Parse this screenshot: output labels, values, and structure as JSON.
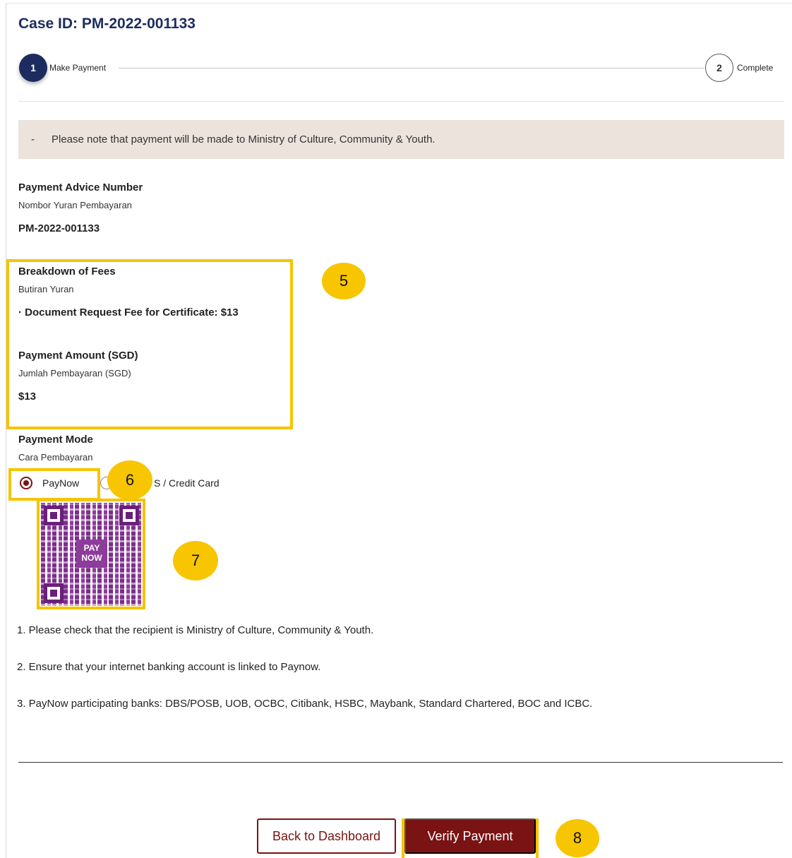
{
  "case": {
    "title": "Case ID: PM-2022-001133"
  },
  "stepper": {
    "steps": [
      {
        "number": "1",
        "label": "Make Payment",
        "state": "active"
      },
      {
        "number": "2",
        "label": "Complete",
        "state": "pending"
      }
    ]
  },
  "notice": {
    "bullet": "-",
    "text": "Please note that payment will be made to Ministry of Culture, Community & Youth."
  },
  "payment_advice": {
    "label": "Payment Advice Number",
    "sub": "Nombor Yuran Pembayaran",
    "value": "PM-2022-001133"
  },
  "fees": {
    "label": "Breakdown of Fees",
    "sub": "Butiran Yuran",
    "item": "· Document Request Fee for Certificate: $13"
  },
  "amount": {
    "label": "Payment Amount (SGD)",
    "sub": "Jumlah Pembayaran (SGD)",
    "value": "$13"
  },
  "payment_mode": {
    "label": "Payment Mode",
    "sub": "Cara Pembayaran",
    "options": [
      {
        "label": "PayNow",
        "selected": true
      },
      {
        "label": "S / Credit Card",
        "selected": false
      }
    ]
  },
  "qr": {
    "logo_text_1": "PAY",
    "logo_text_2": "NOW",
    "icon": "paynow-qr-code"
  },
  "instructions": [
    "1. Please check that the recipient is Ministry of Culture, Community & Youth.",
    "2. Ensure that your internet banking account is linked to Paynow.",
    "3. PayNow participating banks: DBS/POSB, UOB, OCBC, Citibank, HSBC, Maybank, Standard Chartered, BOC and ICBC."
  ],
  "buttons": {
    "back": "Back to Dashboard",
    "verify": "Verify Payment"
  },
  "annotations": {
    "fees_badge": "5",
    "mode_badge": "6",
    "qr_badge": "7",
    "verify_badge": "8"
  },
  "colors": {
    "brand_navy": "#1d2c5e",
    "brand_maroon": "#7a1313",
    "highlight": "#f5c400",
    "notice_bg": "#ebe3dc",
    "qr_purple": "#7b2d8a"
  }
}
